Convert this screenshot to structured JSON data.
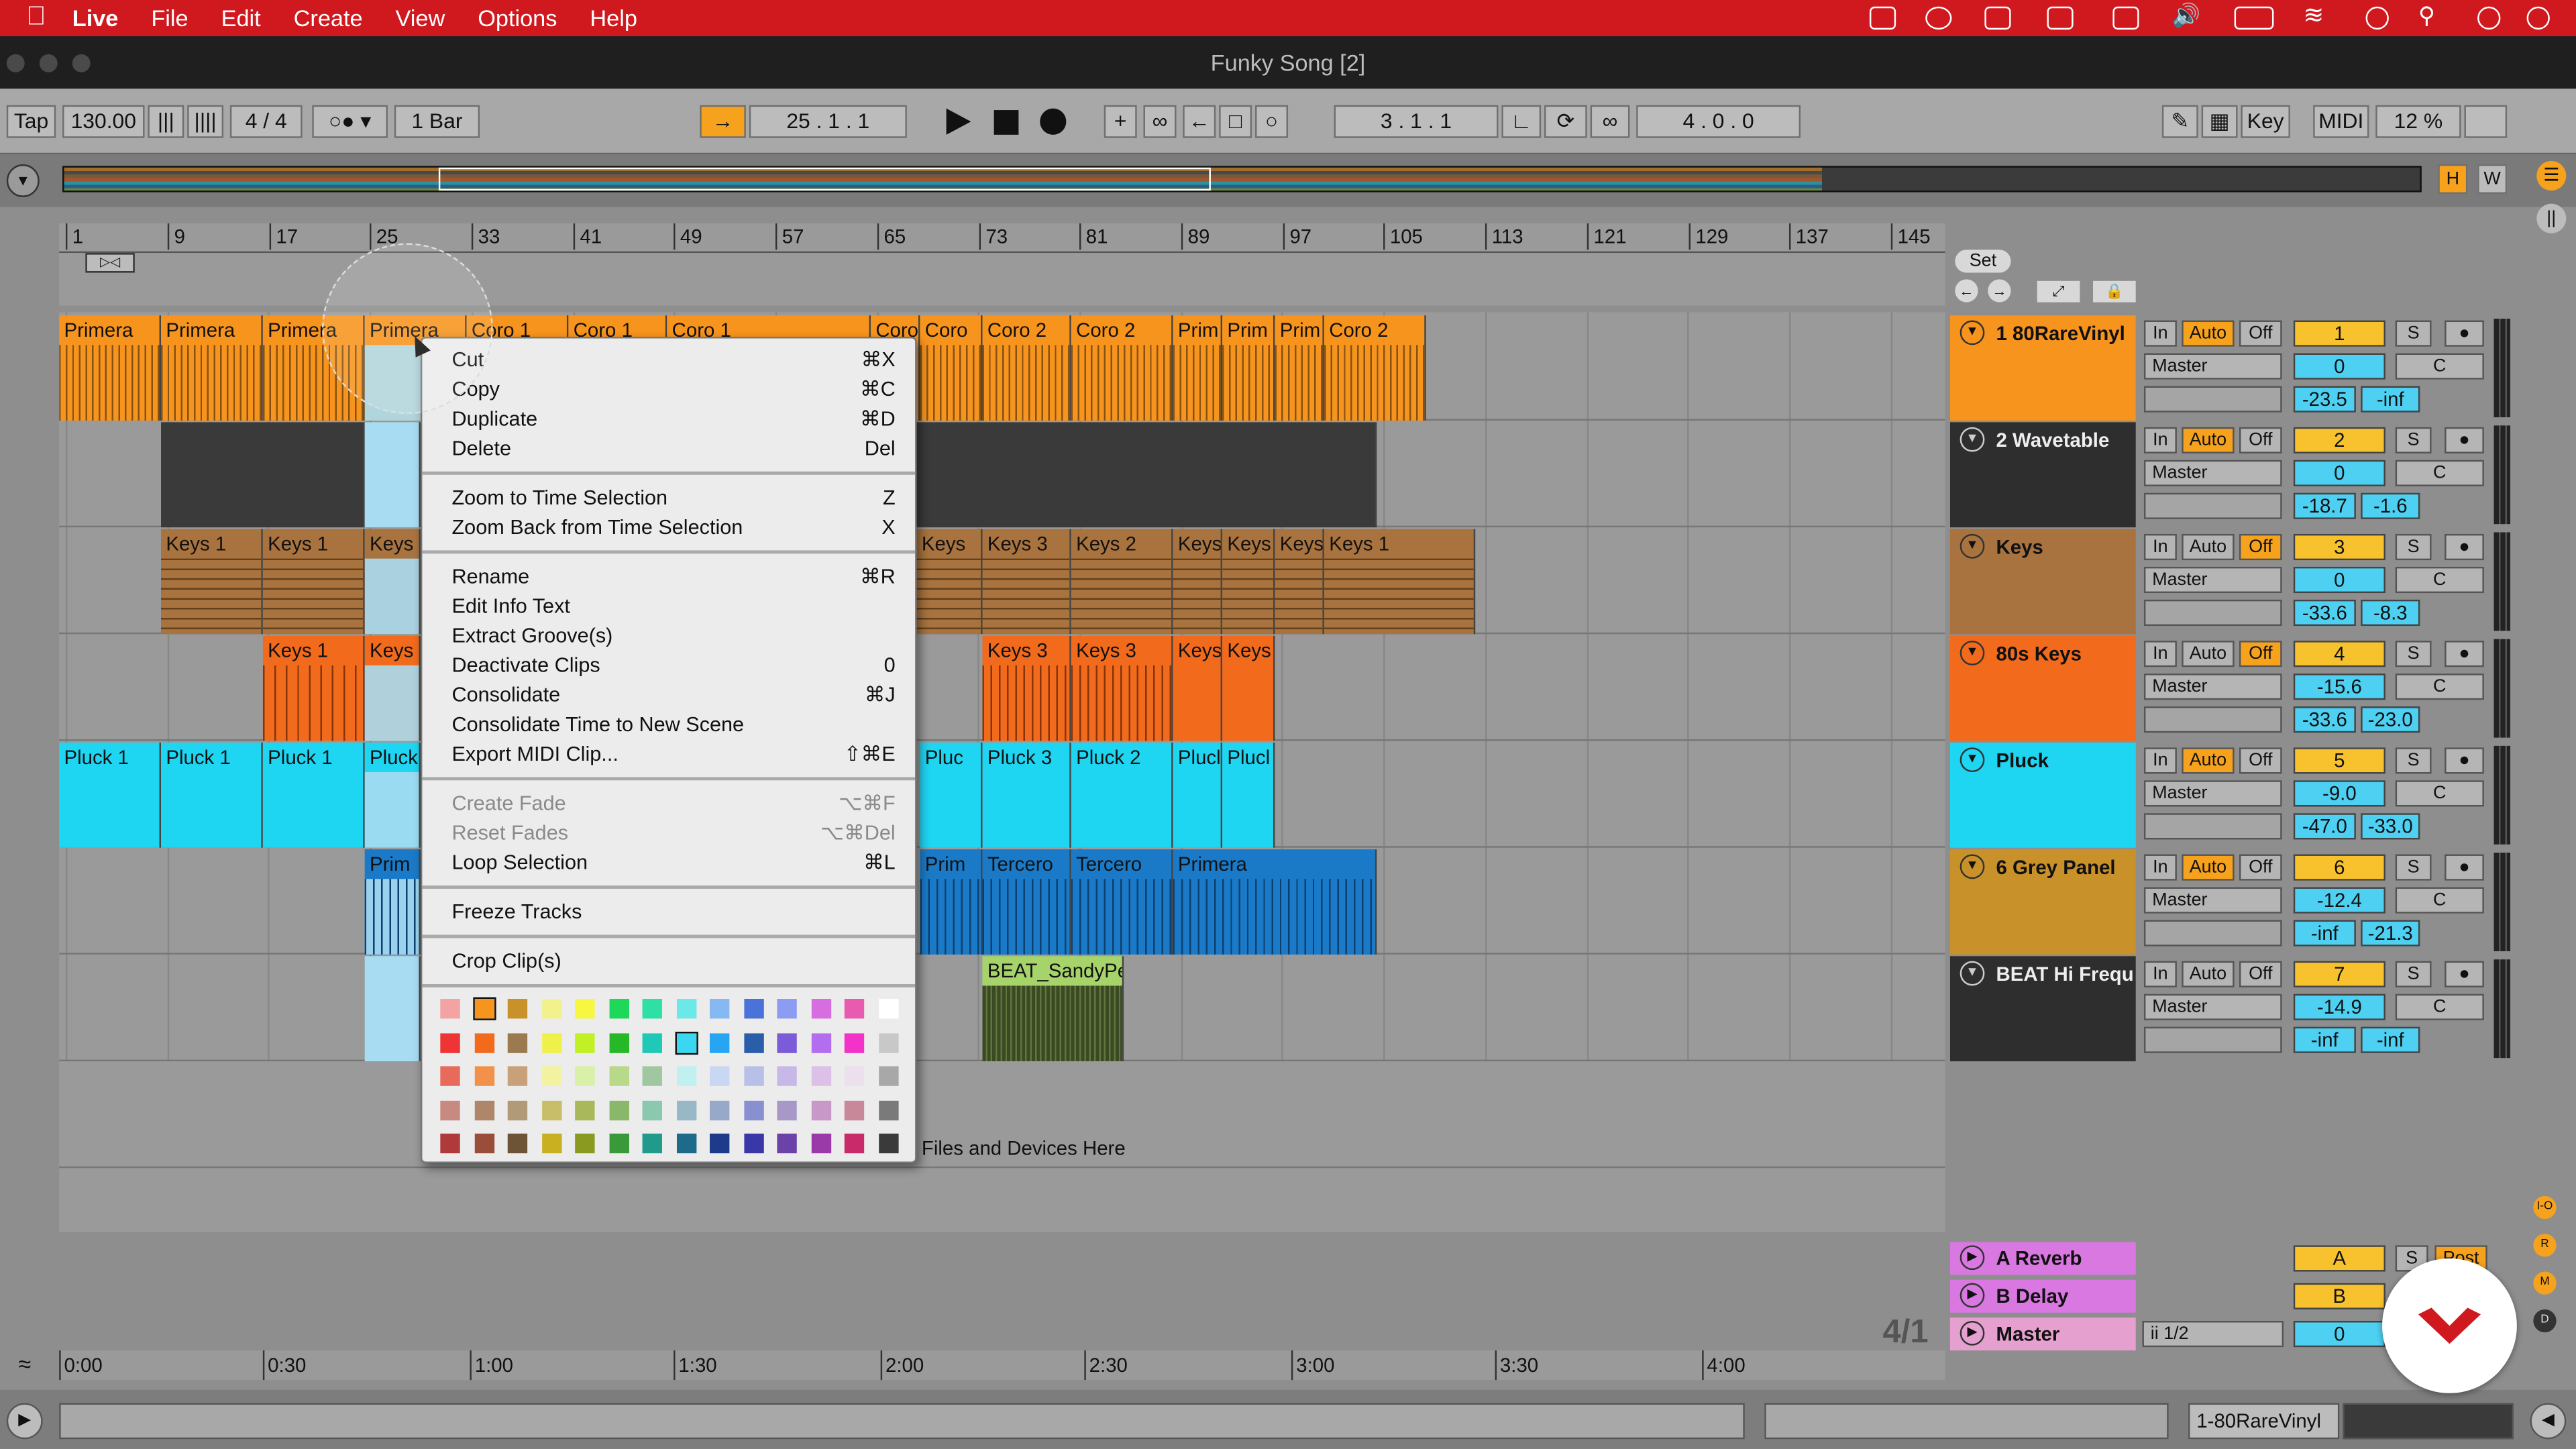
{
  "menubar": {
    "app": "Live",
    "items": [
      "File",
      "Edit",
      "Create",
      "View",
      "Options",
      "Help"
    ]
  },
  "window": {
    "title": "Funky Song  [2]"
  },
  "control": {
    "tap": "Tap",
    "tempo": "130.00",
    "signature": "4 / 4",
    "quantize": "1 Bar",
    "position": "25 .   1 .   1",
    "loop_start": "3 .   1 .   1",
    "loop_length": "4 .   0 .   0",
    "key": "Key",
    "midi": "MIDI",
    "zoom": "12 %",
    "h": "H",
    "w": "W"
  },
  "ruler": [
    "1",
    "9",
    "17",
    "25",
    "33",
    "41",
    "49",
    "57",
    "65",
    "73",
    "81",
    "89",
    "97",
    "105",
    "113",
    "121",
    "129",
    "137",
    "145"
  ],
  "set_label": "Set",
  "tracks": [
    {
      "name": "1 80RareVinyl",
      "color": "#f7941d",
      "num": "1",
      "pan": "0",
      "center": "C",
      "vol1": "-23.5",
      "vol2": "-inf",
      "auto": true,
      "off": false,
      "output": "Master"
    },
    {
      "name": "2 Wavetable",
      "color": "#2e2e2e",
      "num": "2",
      "pan": "0",
      "center": "C",
      "vol1": "-18.7",
      "vol2": "-1.6",
      "auto": true,
      "off": false,
      "output": "Master"
    },
    {
      "name": "Keys",
      "color": "#a8733e",
      "num": "3",
      "pan": "0",
      "center": "C",
      "vol1": "-33.6",
      "vol2": "-8.3",
      "auto": false,
      "off": true,
      "output": "Master"
    },
    {
      "name": "80s Keys",
      "color": "#f26b1d",
      "num": "4",
      "pan": "-15.6",
      "center": "C",
      "vol1": "-33.6",
      "vol2": "-23.0",
      "auto": false,
      "off": true,
      "output": "Master"
    },
    {
      "name": "Pluck",
      "color": "#1ed5f2",
      "num": "5",
      "pan": "-9.0",
      "center": "C",
      "vol1": "-47.0",
      "vol2": "-33.0",
      "auto": true,
      "off": false,
      "output": "Master"
    },
    {
      "name": "6 Grey Panel",
      "color": "#c8912a",
      "num": "6",
      "pan": "-12.4",
      "center": "C",
      "vol1": "-inf",
      "vol2": "-21.3",
      "auto": true,
      "off": false,
      "output": "Master"
    },
    {
      "name": "BEAT Hi Frequ",
      "color": "#2e2e2e",
      "num": "7",
      "pan": "-14.9",
      "center": "C",
      "vol1": "-inf",
      "vol2": "-inf",
      "auto": false,
      "off": false,
      "output": "Master"
    }
  ],
  "io_labels": {
    "in": "In",
    "auto": "Auto",
    "off": "Off",
    "solo": "S"
  },
  "returns": [
    {
      "name": "A Reverb",
      "letter": "A",
      "post": "Post"
    },
    {
      "name": "B Delay",
      "letter": "B"
    },
    {
      "name": "Master",
      "letter": "0",
      "output": "ii 1/2"
    }
  ],
  "clips": {
    "t1": [
      "Primera",
      "Primera",
      "Primera",
      "Primera",
      "Coro 1",
      "Coro 1",
      "Coro 1",
      "Coro",
      "Coro",
      "Coro 2",
      "Coro 2",
      "Prim",
      "Prim",
      "Prim",
      "Coro 2"
    ],
    "t3": [
      "Keys 1",
      "Keys 1",
      "Keys",
      "Keys",
      "Keys 3",
      "Keys 2",
      "Keys",
      "Keys",
      "Keys",
      "Keys 1"
    ],
    "t4": [
      "Keys 1",
      "Keys",
      "Keys 3",
      "Keys 3",
      "Keys",
      "Keys"
    ],
    "t5": [
      "Pluck 1",
      "Pluck 1",
      "Pluck 1",
      "Pluck",
      "Pluc",
      "Pluck 3",
      "Pluck 2",
      "Plucl",
      "Plucl"
    ],
    "t6": [
      "Prim",
      "Prim",
      "Tercero",
      "Tercero",
      "Primera"
    ],
    "t7": [
      "BEAT_SandyPe"
    ]
  },
  "drop_hint": "Files and Devices Here",
  "menu": {
    "g1": [
      {
        "label": "Cut",
        "sc": "⌘X"
      },
      {
        "label": "Copy",
        "sc": "⌘C"
      },
      {
        "label": "Duplicate",
        "sc": "⌘D"
      },
      {
        "label": "Delete",
        "sc": "Del"
      }
    ],
    "g2": [
      {
        "label": "Zoom to Time Selection",
        "sc": "Z"
      },
      {
        "label": "Zoom Back from Time Selection",
        "sc": "X"
      }
    ],
    "g3": [
      {
        "label": "Rename",
        "sc": "⌘R"
      },
      {
        "label": "Edit Info Text",
        "sc": ""
      },
      {
        "label": "Extract Groove(s)",
        "sc": ""
      },
      {
        "label": "Deactivate Clips",
        "sc": "0"
      },
      {
        "label": "Consolidate",
        "sc": "⌘J"
      },
      {
        "label": "Consolidate Time to New Scene",
        "sc": ""
      },
      {
        "label": "Export MIDI Clip...",
        "sc": "⇧⌘E"
      }
    ],
    "g4": [
      {
        "label": "Create Fade",
        "sc": "⌥⌘F"
      },
      {
        "label": "Reset Fades",
        "sc": "⌥⌘Del"
      },
      {
        "label": "Loop Selection",
        "sc": "⌘L"
      }
    ],
    "g5": [
      {
        "label": "Freeze Tracks",
        "sc": ""
      }
    ],
    "g6": [
      {
        "label": "Crop Clip(s)",
        "sc": ""
      }
    ]
  },
  "swatches": [
    [
      "#f4a3a3",
      "#f7941d",
      "#c8912a",
      "#f2f28c",
      "#f7f742",
      "#1ed85a",
      "#2ee0a6",
      "#6ce8e8",
      "#86b8f2",
      "#4a72d8",
      "#8c9cf2",
      "#d66ee0",
      "#e85cb0",
      "#ffffff"
    ],
    [
      "#ee3434",
      "#f26b1d",
      "#9b7a50",
      "#f0f04a",
      "#c0f025",
      "#26b826",
      "#20c8b8",
      "#3ad7f2",
      "#26a6f2",
      "#2a5ea8",
      "#7a5cd8",
      "#b36ef0",
      "#f232c8",
      "#c8c8c8"
    ],
    [
      "#e86a5a",
      "#f2924a",
      "#c8a07a",
      "#f2f2a0",
      "#d8f0a8",
      "#b8d88a",
      "#a0c8a0",
      "#c0f0f0",
      "#c8d8f2",
      "#b8c0e8",
      "#c8b8e8",
      "#dcc0e8",
      "#ece0ec",
      "#a8a8a8"
    ],
    [
      "#c88a80",
      "#b0866a",
      "#b09a78",
      "#c8be6a",
      "#a8b85a",
      "#8ab86a",
      "#8ac8b0",
      "#98b8c8",
      "#98a8c8",
      "#8890d0",
      "#a898c8",
      "#c898c8",
      "#c8889a",
      "#7a7a7a"
    ],
    [
      "#b03a3a",
      "#9a4e3a",
      "#6e5436",
      "#c8b020",
      "#8a9a20",
      "#3a9a3a",
      "#209a8a",
      "#1e6a8a",
      "#1e3a8a",
      "#3a38a8",
      "#6a42a8",
      "#9a3aa8",
      "#c82a6a",
      "#3a3a3a"
    ]
  ],
  "timeline": [
    "0:00",
    "0:30",
    "1:00",
    "1:30",
    "2:00",
    "2:30",
    "3:00",
    "3:30",
    "4:00"
  ],
  "bottom": {
    "track_label": "1-80RareVinyl",
    "ratio": "4/1"
  }
}
